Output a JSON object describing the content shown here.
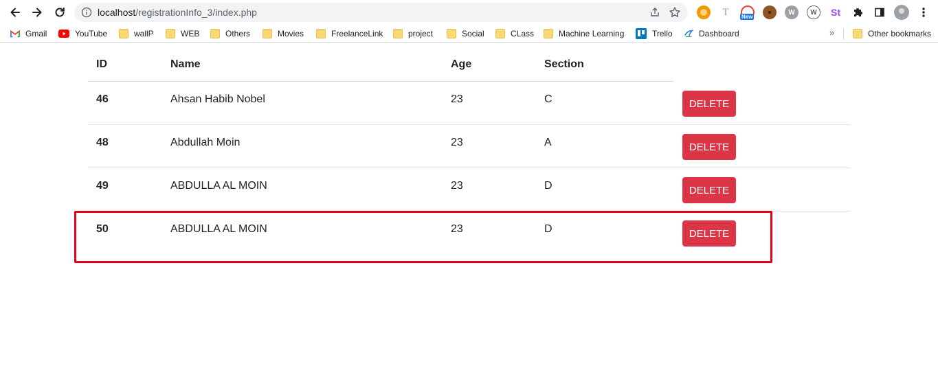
{
  "browser": {
    "url_host": "localhost",
    "url_path": "/registrationInfo_3/index.php",
    "extensions": [
      {
        "name": "extension-orange-icon",
        "color": "#f29900"
      },
      {
        "name": "extension-t-icon",
        "color": "#9aa0a6"
      },
      {
        "name": "extension-new-icon",
        "badge": "New",
        "color": "#1a73e8"
      },
      {
        "name": "extension-cookie-icon",
        "color": "#8d5524"
      },
      {
        "name": "extension-wordpress-icon",
        "color": "#5f6368"
      },
      {
        "name": "extension-wordpress2-icon",
        "color": "#5f6368"
      },
      {
        "name": "extension-st-icon",
        "label": "St",
        "color": "#a142f4"
      },
      {
        "name": "extensions-puzzle-icon",
        "color": "#202124"
      },
      {
        "name": "side-panel-icon",
        "color": "#202124"
      },
      {
        "name": "profile-avatar",
        "color": "#9aa0a6"
      },
      {
        "name": "menu-icon",
        "color": "#202124"
      }
    ]
  },
  "bookmarks": [
    {
      "label": "Gmail",
      "icon": "gmail-icon"
    },
    {
      "label": "YouTube",
      "icon": "youtube-icon"
    },
    {
      "label": "wallP",
      "icon": "folder-icon"
    },
    {
      "label": "WEB",
      "icon": "folder-icon"
    },
    {
      "label": "Others",
      "icon": "folder-icon"
    },
    {
      "label": "Movies",
      "icon": "folder-icon"
    },
    {
      "label": "FreelanceLink",
      "icon": "folder-icon"
    },
    {
      "label": "project",
      "icon": "folder-icon"
    },
    {
      "label": "Social",
      "icon": "folder-icon"
    },
    {
      "label": "CLass",
      "icon": "folder-icon"
    },
    {
      "label": "Machine Learning",
      "icon": "folder-icon"
    },
    {
      "label": "Trello",
      "icon": "trello-icon"
    },
    {
      "label": "Dashboard",
      "icon": "dashboard-icon"
    }
  ],
  "bookmarks_overflow": "»",
  "other_bookmarks": "Other bookmarks",
  "table": {
    "headers": {
      "id": "ID",
      "name": "Name",
      "age": "Age",
      "section": "Section"
    },
    "delete_label": "DELETE",
    "rows": [
      {
        "id": "46",
        "name": "Ahsan Habib Nobel",
        "age": "23",
        "section": "C"
      },
      {
        "id": "48",
        "name": "Abdullah Moin",
        "age": "23",
        "section": "A"
      },
      {
        "id": "49",
        "name": "ABDULLA AL MOIN",
        "age": "23",
        "section": "D"
      },
      {
        "id": "50",
        "name": "ABDULLA AL MOIN",
        "age": "23",
        "section": "D"
      }
    ]
  },
  "colors": {
    "delete_button": "#dc3545",
    "highlight_border": "#e0001b"
  }
}
